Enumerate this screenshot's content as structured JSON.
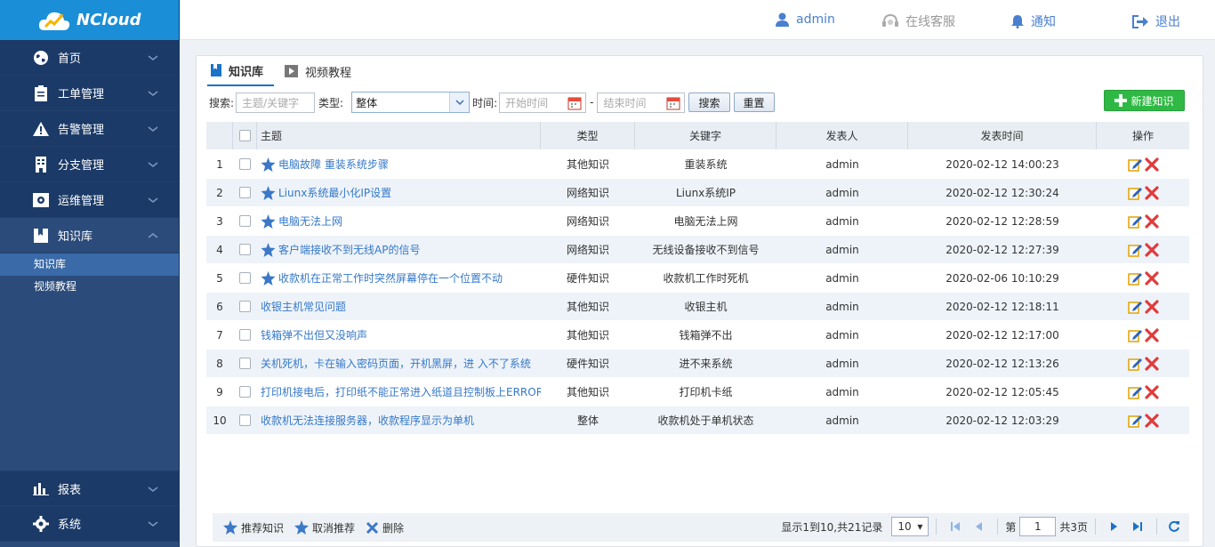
{
  "app": {
    "name": "NCloud"
  },
  "topbar": {
    "user": "admin",
    "service": "在线客服",
    "notify": "通知",
    "logout": "退出"
  },
  "sidebar": {
    "items": [
      {
        "label": "首页",
        "icon": "globe-icon"
      },
      {
        "label": "工单管理",
        "icon": "clipboard-icon"
      },
      {
        "label": "告警管理",
        "icon": "warning-icon"
      },
      {
        "label": "分支管理",
        "icon": "building-icon"
      },
      {
        "label": "运维管理",
        "icon": "settings-box-icon"
      },
      {
        "label": "知识库",
        "icon": "book-icon"
      }
    ],
    "subitems": [
      {
        "label": "知识库",
        "active": true
      },
      {
        "label": "视频教程",
        "active": false
      }
    ],
    "bottom": [
      {
        "label": "报表",
        "icon": "bar-chart-icon"
      },
      {
        "label": "系统",
        "icon": "gear-icon"
      }
    ]
  },
  "tabs": [
    {
      "label": "知识库",
      "active": true
    },
    {
      "label": "视频教程",
      "active": false
    }
  ],
  "filter": {
    "search_label": "搜索:",
    "search_placeholder": "主题/关键字",
    "type_label": "类型:",
    "type_value": "整体",
    "time_label": "时间:",
    "start_placeholder": "开始时间",
    "dash": "-",
    "end_placeholder": "结束时间",
    "search_btn": "搜索",
    "reset_btn": "重置",
    "new_btn": "新建知识"
  },
  "table": {
    "headers": {
      "subject": "主题",
      "type": "类型",
      "keyword": "关键字",
      "author": "发表人",
      "time": "发表时间",
      "ops": "操作"
    },
    "rows": [
      {
        "no": "1",
        "subject": "电脑故障 重装系统步骤",
        "star": true,
        "type": "其他知识",
        "keyword": "重装系统",
        "author": "admin",
        "time": "2020-02-12 14:00:23"
      },
      {
        "no": "2",
        "subject": "Liunx系统最小化IP设置",
        "star": true,
        "type": "网络知识",
        "keyword": "Liunx系统IP",
        "author": "admin",
        "time": "2020-02-12 12:30:24"
      },
      {
        "no": "3",
        "subject": "电脑无法上网",
        "star": true,
        "type": "网络知识",
        "keyword": "电脑无法上网",
        "author": "admin",
        "time": "2020-02-12 12:28:59"
      },
      {
        "no": "4",
        "subject": "客户端接收不到无线AP的信号",
        "star": true,
        "type": "网络知识",
        "keyword": "无线设备接收不到信号",
        "author": "admin",
        "time": "2020-02-12 12:27:39"
      },
      {
        "no": "5",
        "subject": "收款机在正常工作时突然屏幕停在一个位置不动",
        "star": true,
        "type": "硬件知识",
        "keyword": "收款机工作时死机",
        "author": "admin",
        "time": "2020-02-06 10:10:29"
      },
      {
        "no": "6",
        "subject": "收银主机常见问题",
        "star": false,
        "type": "其他知识",
        "keyword": "收银主机",
        "author": "admin",
        "time": "2020-02-12 12:18:11"
      },
      {
        "no": "7",
        "subject": "钱箱弹不出但又没响声",
        "star": false,
        "type": "其他知识",
        "keyword": "钱箱弹不出",
        "author": "admin",
        "time": "2020-02-12 12:17:00"
      },
      {
        "no": "8",
        "subject": "关机死机，卡在输入密码页面，开机黑屏，进 入不了系统",
        "star": false,
        "type": "硬件知识",
        "keyword": "进不来系统",
        "author": "admin",
        "time": "2020-02-12 12:13:26"
      },
      {
        "no": "9",
        "subject": "打印机接电后，打印纸不能正常进入纸道且控制板上ERROR",
        "star": false,
        "type": "其他知识",
        "keyword": "打印机卡纸",
        "author": "admin",
        "time": "2020-02-12 12:05:45"
      },
      {
        "no": "10",
        "subject": "收款机无法连接服务器，收款程序显示为单机",
        "star": false,
        "type": "整体",
        "keyword": "收款机处于单机状态",
        "author": "admin",
        "time": "2020-02-12 12:03:29"
      }
    ]
  },
  "footer": {
    "recommend": "推荐知识",
    "unrecommend": "取消推荐",
    "delete": "删除",
    "summary": "显示1到10,共21记录",
    "page_size": "10",
    "page_prefix": "第",
    "page_value": "1",
    "page_total": "共3页"
  },
  "colors": {
    "brand": "#1a8fd8",
    "sidebar": "#1b3a67",
    "link": "#3578c9",
    "green": "#2fb944"
  }
}
